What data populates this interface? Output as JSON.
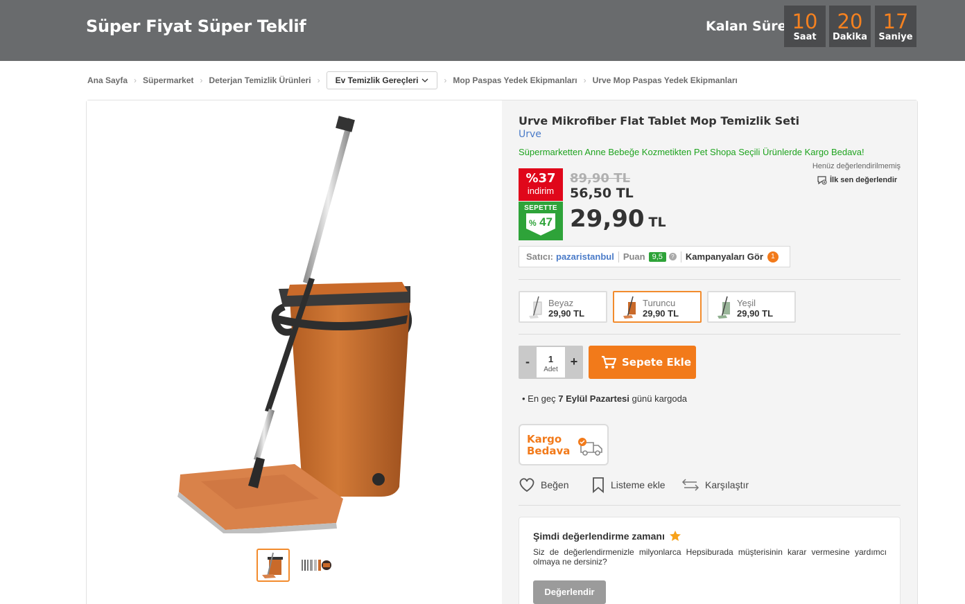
{
  "banner": {
    "title": "Süper Fiyat Süper Teklif",
    "countdown_label": "Kalan Süre",
    "hours": "10",
    "hours_label": "Saat",
    "minutes": "20",
    "minutes_label": "Dakika",
    "seconds": "17",
    "seconds_label": "Saniye"
  },
  "breadcrumb": {
    "items": [
      "Ana Sayfa",
      "Süpermarket",
      "Deterjan Temizlik Ürünleri",
      "Ev Temizlik Gereçleri",
      "Mop Paspas Yedek Ekipmanları",
      "Urve Mop Paspas Yedek Ekipmanları"
    ]
  },
  "product": {
    "title": "Urve Mikrofiber Flat Tablet Mop Temizlik Seti",
    "brand": "Urve",
    "promo": "Süpermarketten Anne Bebeğe Kozmetikten Pet Shopa Seçili Ürünlerde Kargo Bedava!",
    "rating_status": "Henüz değerlendirilmemiş",
    "rate_first": "İlk sen değerlendir",
    "discount_pct": "%37",
    "discount_label": "indirim",
    "basket_label": "SEPETTE",
    "basket_pct_sign": "%",
    "basket_pct": "47",
    "old_price": "89,90 TL",
    "mid_price": "56,50 TL",
    "price": "29,90",
    "currency": "TL"
  },
  "seller": {
    "label": "Satıcı:",
    "name": "pazaristanbul",
    "score_label": "Puan",
    "score": "9,5",
    "help": "?",
    "campaigns_label": "Kampanyaları Gör",
    "campaigns_count": "1"
  },
  "variants": [
    {
      "name": "Beyaz",
      "price": "29,90 TL"
    },
    {
      "name": "Turuncu",
      "price": "29,90 TL"
    },
    {
      "name": "Yeşil",
      "price": "29,90 TL"
    }
  ],
  "cart": {
    "minus": "-",
    "plus": "+",
    "quantity": "1",
    "unit": "Adet",
    "add_label": "Sepete Ekle"
  },
  "delivery": {
    "prefix": "En geç",
    "date": "7 Eylül Pazartesi",
    "suffix": "günü kargoda"
  },
  "shipping_badge": {
    "line1": "Kargo",
    "line2": "Bedava"
  },
  "actions": {
    "like": "Beğen",
    "list": "Listeme ekle",
    "compare": "Karşılaştır"
  },
  "review": {
    "title": "Şimdi değerlendirme zamanı",
    "text": "Siz de değerlendirmenizle milyonlarca Hepsiburada müşterisinin karar vermesine yardımcı olmaya ne dersiniz?",
    "button": "Değerlendir"
  },
  "colors": {
    "accent": "#f27a1a",
    "discount_red": "#e0071a",
    "discount_green": "#2ea339",
    "link_blue": "#4a7bc8",
    "banner_gray": "#696b6d"
  }
}
